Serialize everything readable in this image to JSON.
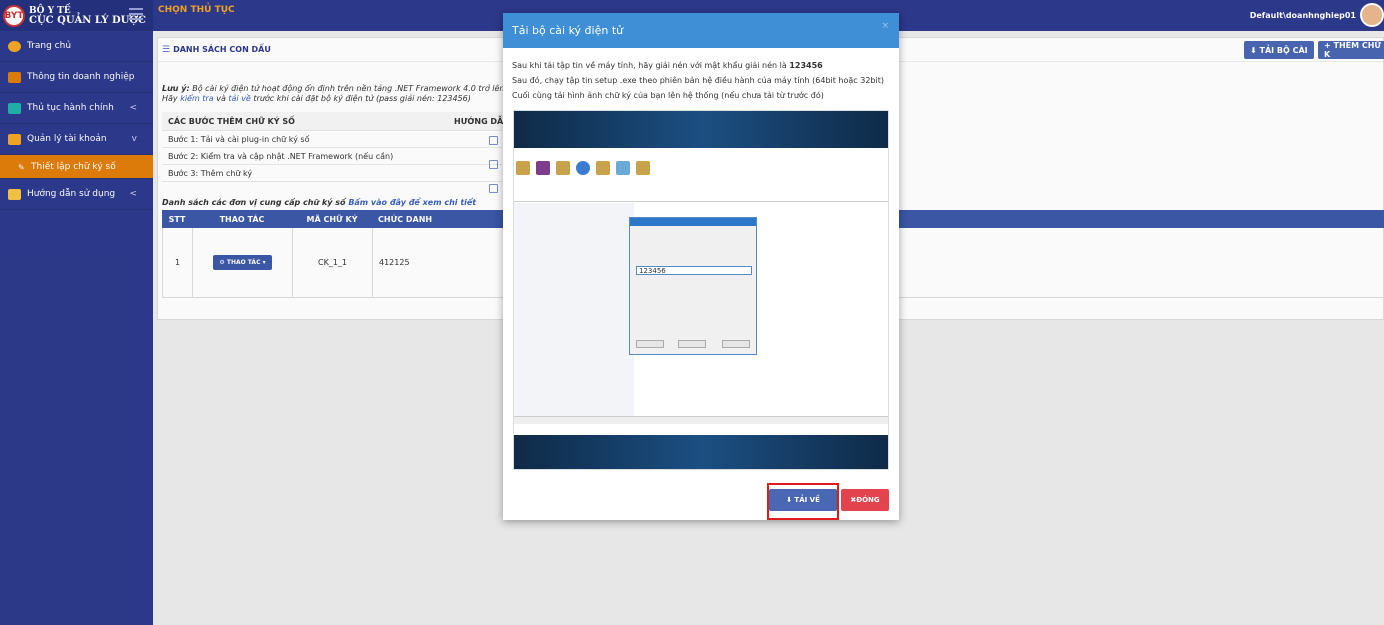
{
  "brand": {
    "logo_text": "BYT",
    "line1": "BỘ Y TẾ",
    "line2": "CỤC QUẢN LÝ DƯỢC"
  },
  "topbar": {
    "title": "CHỌN THỦ TỤC",
    "user": "Default\\doanhnghiep01"
  },
  "sidebar": {
    "items": [
      {
        "label": "Trang chủ",
        "color": "#f5a623"
      },
      {
        "label": "Thông tin doanh nghiệp",
        "color": "#e17e0a"
      },
      {
        "label": "Thủ tục hành chính",
        "color": "#20b2aa",
        "chevron": "<"
      },
      {
        "label": "Quản lý tài khoản",
        "color": "#f5a623",
        "chevron": "v"
      },
      {
        "label": "Thiết lập chữ ký số",
        "color": "#ffffff"
      },
      {
        "label": "Hướng dẫn sử dụng",
        "color": "#f5c542",
        "chevron": "<"
      }
    ]
  },
  "main": {
    "panel_title": "DANH SÁCH CON DẤU",
    "btn_download": "⬇ TẢI BỘ CÀI",
    "btn_add": "+ THÊM CHỮ K",
    "note": {
      "label": "Lưu ý:",
      "line1": "Bộ cài ký điện tử hoạt động ổn định trên nền tảng .NET Framework 4.0 trở lên v",
      "line2_pre": "Hãy",
      "line2_link1": "kiểm tra",
      "line2_mid": "và",
      "line2_link2": "tải về",
      "line2_post": "trước khi cài đặt bộ ký điện tử (pass giải nén: 123456)"
    },
    "steps_header": "CÁC BƯỚC THÊM CHỮ KÝ SỐ",
    "steps_right": "HƯỚNG DẪ",
    "steps": [
      "Bước 1: Tải và cài plug-in chữ ký số",
      "Bước 2: Kiểm tra và cập nhật .NET Framework (nếu cần)",
      "Bước 3: Thêm chữ ký"
    ],
    "list_title": "Danh sách các đơn vị cung cấp chữ ký số",
    "list_link": "Bấm vào đây để xem chi tiết",
    "table": {
      "headers": [
        "STT",
        "THAO TÁC",
        "MÃ CHỮ KÝ",
        "CHỨC DANH"
      ],
      "rows": [
        {
          "stt": "1",
          "action": "⚙ THAO TÁC ▾",
          "code": "CK_1_1",
          "title": "412125"
        }
      ]
    }
  },
  "modal": {
    "title": "Tải bộ cài ký điện tử",
    "close": "×",
    "line1_pre": "Sau khi tải tập tin về máy tính, hãy giải nén với mật khẩu giải nén là",
    "line1_pwd": "123456",
    "line2": "Sau đó, chạy tập tin setup .exe theo phiên bản hệ điều hành của máy tính (64bit hoặc 32bit)",
    "line3": "Cuối cùng tải hình ảnh chữ ký của bạn lên hệ thống (nếu chưa tải từ trước đó)",
    "screenshot_password": "123456",
    "btn_download": "⬇ TẢI VỀ",
    "btn_close": "✖ĐÓNG",
    "colors": {
      "header": "#3f8fd6",
      "download": "#4a67b3",
      "close": "#e2434d",
      "highlight": "#e01b1b"
    }
  }
}
